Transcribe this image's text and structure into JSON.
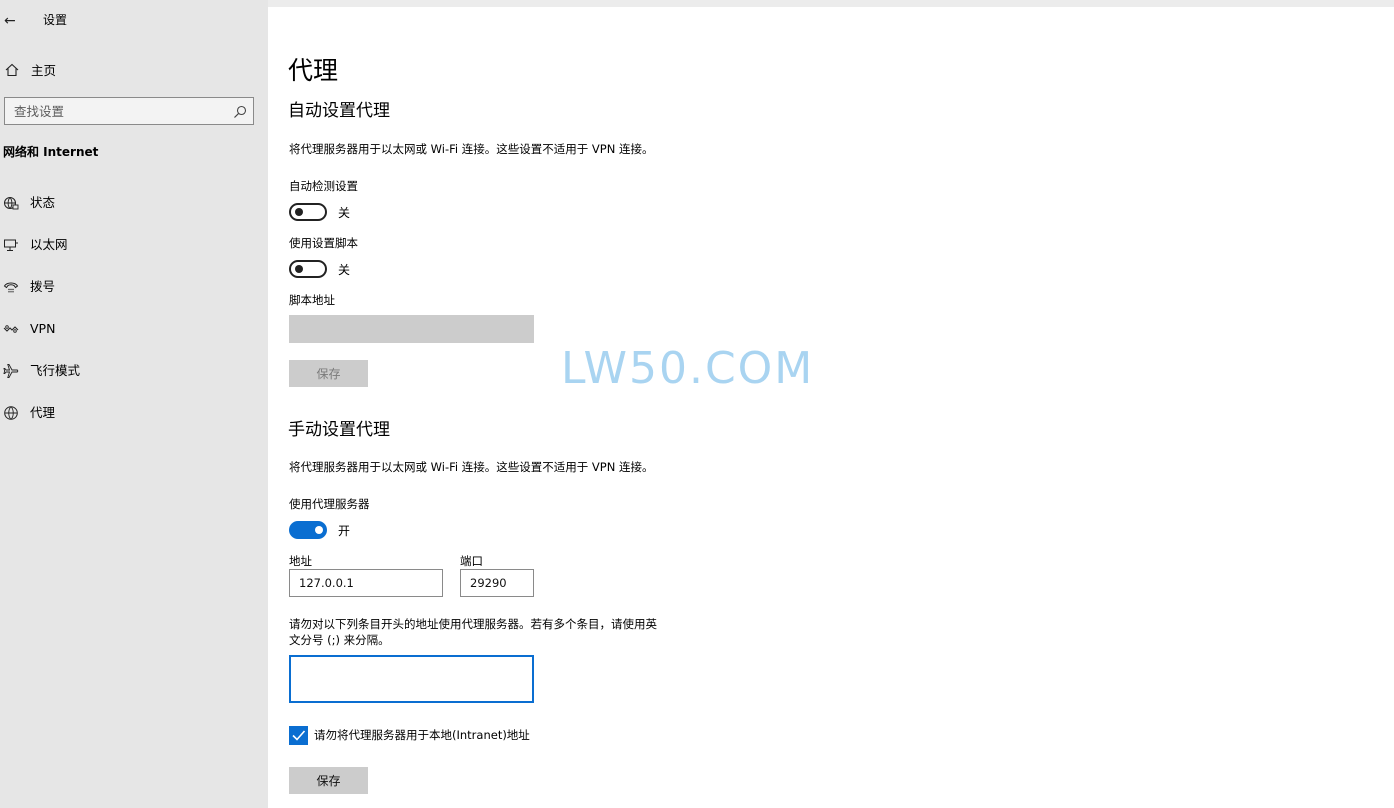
{
  "window": {
    "title": "设置",
    "back_icon": "back-arrow-icon"
  },
  "sidebar": {
    "home": {
      "label": "主页",
      "icon": "home-icon"
    },
    "search": {
      "placeholder": "查找设置",
      "icon": "search-icon"
    },
    "section_title": "网络和 Internet",
    "items": [
      {
        "label": "状态",
        "icon": "globe-status-icon"
      },
      {
        "label": "以太网",
        "icon": "ethernet-icon"
      },
      {
        "label": "拨号",
        "icon": "dialup-icon"
      },
      {
        "label": "VPN",
        "icon": "vpn-icon"
      },
      {
        "label": "飞行模式",
        "icon": "airplane-icon"
      },
      {
        "label": "代理",
        "icon": "globe-proxy-icon"
      }
    ]
  },
  "main": {
    "title": "代理",
    "auto": {
      "heading": "自动设置代理",
      "description": "将代理服务器用于以太网或 Wi-Fi 连接。这些设置不适用于 VPN 连接。",
      "detect": {
        "label": "自动检测设置",
        "state": "关",
        "on": false
      },
      "script": {
        "label": "使用设置脚本",
        "state": "关",
        "on": false
      },
      "script_address_label": "脚本地址",
      "script_address_value": "",
      "save_label": "保存"
    },
    "manual": {
      "heading": "手动设置代理",
      "description": "将代理服务器用于以太网或 Wi-Fi 连接。这些设置不适用于 VPN 连接。",
      "use_proxy": {
        "label": "使用代理服务器",
        "state": "开",
        "on": true
      },
      "address_label": "地址",
      "address_value": "127.0.0.1",
      "port_label": "端口",
      "port_value": "29290",
      "exceptions_label_line1": "请勿对以下列条目开头的地址使用代理服务器。若有多个条目，请使用英",
      "exceptions_label_line2": "文分号 (;) 来分隔。",
      "exceptions_value": "",
      "bypass_local_label": "请勿将代理服务器用于本地(Intranet)地址",
      "bypass_local_checked": true,
      "save_label": "保存"
    },
    "watermark": "LW50.COM"
  },
  "colors": {
    "accent": "#0a6ed1",
    "sidebar_bg": "#e6e6e6",
    "disabled": "#cccccc",
    "watermark": "#a9d4f1"
  }
}
